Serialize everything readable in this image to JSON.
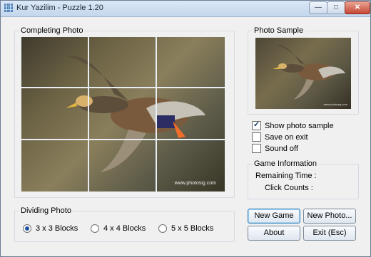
{
  "window": {
    "title": "Kur Yazilim - Puzzle 1.20",
    "controls": [
      "minimize",
      "maximize",
      "close"
    ]
  },
  "completing_photo": {
    "label": "Completing Photo",
    "watermark": "www.photosig.com"
  },
  "photo_sample": {
    "label": "Photo Sample",
    "watermark": "www.photosig.com"
  },
  "options": {
    "show_photo_sample": {
      "label": "Show photo sample",
      "checked": true
    },
    "save_on_exit": {
      "label": "Save on exit",
      "checked": false
    },
    "sound_off": {
      "label": "Sound off",
      "checked": false
    }
  },
  "game_info": {
    "label": "Game Information",
    "remaining_time_label": "Remaining Time :",
    "click_counts_label": "Click Counts :"
  },
  "dividing_photo": {
    "label": "Dividing Photo",
    "options": [
      {
        "label": "3 x 3 Blocks",
        "selected": true
      },
      {
        "label": "4 x 4 Blocks",
        "selected": false
      },
      {
        "label": "5 x 5 Blocks",
        "selected": false
      }
    ]
  },
  "buttons": {
    "new_game": "New Game",
    "new_photo": "New Photo...",
    "about": "About",
    "exit": "Exit (Esc)"
  },
  "icons": {
    "app": "grid-icon",
    "check": "checkmark-icon"
  },
  "colors": {
    "title_bar": "#c3d6ec",
    "close_button": "#c54834",
    "selection": "#1f4f9a"
  }
}
